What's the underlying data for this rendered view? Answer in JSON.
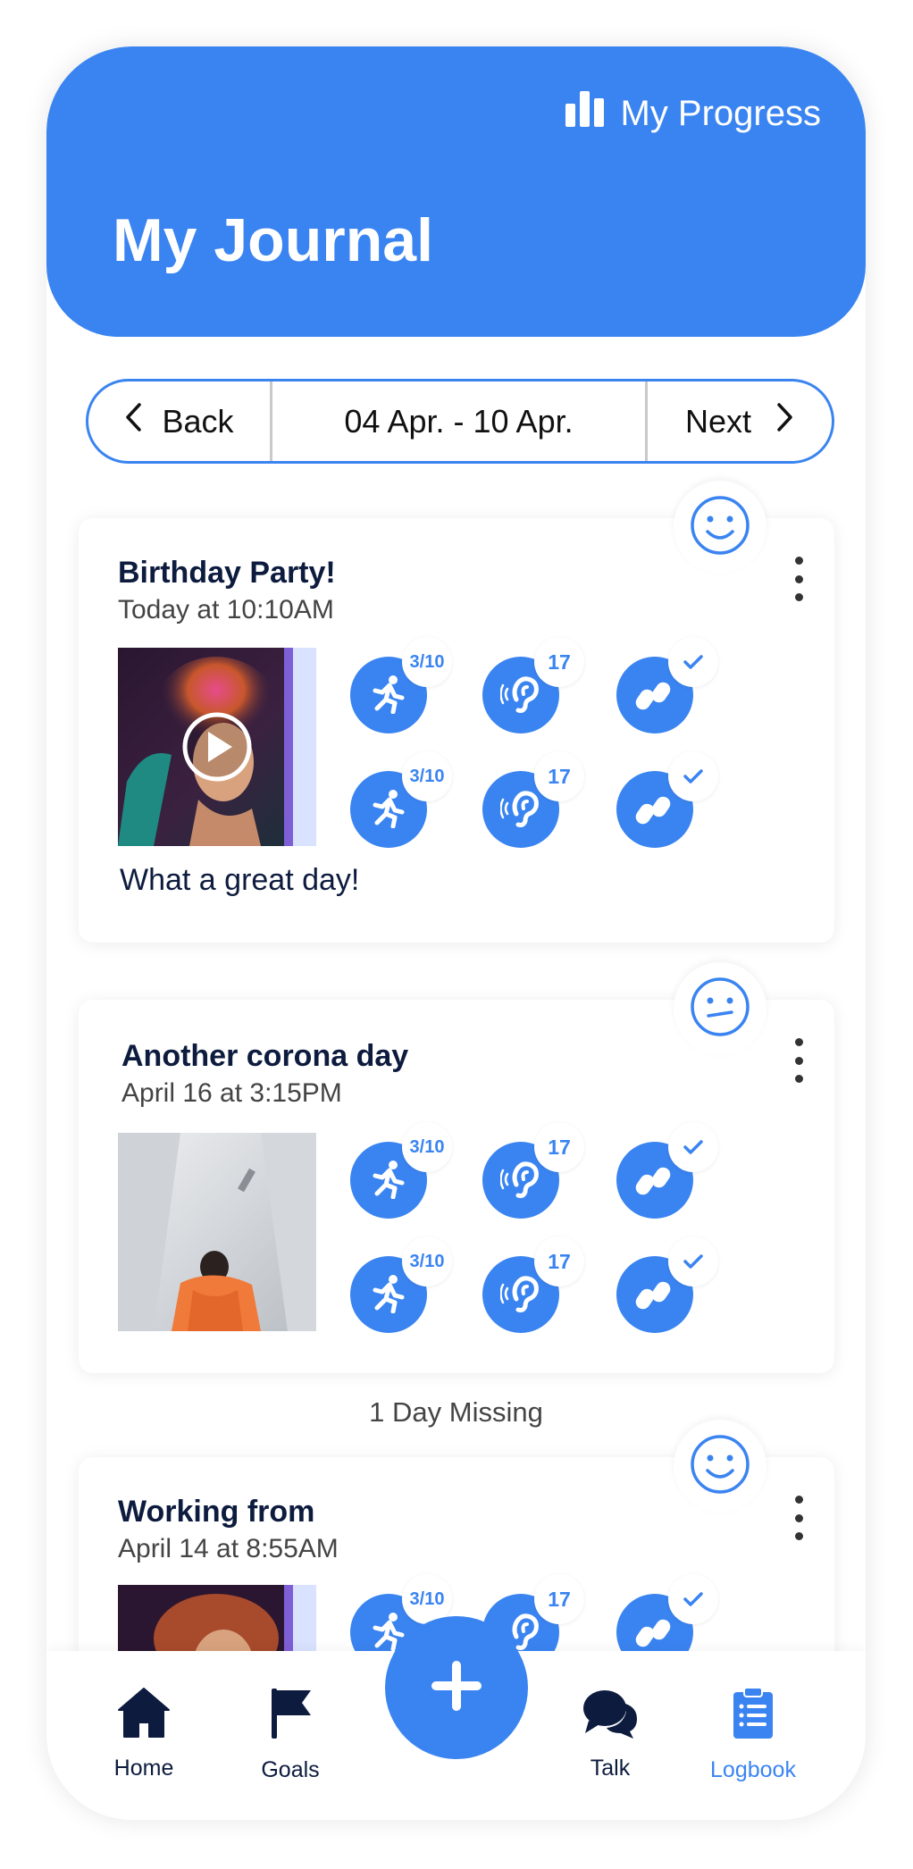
{
  "header": {
    "progress_label": "My Progress",
    "title": "My Journal"
  },
  "week_nav": {
    "back_label": "Back",
    "range": "04 Apr. - 10 Apr.",
    "next_label": "Next"
  },
  "entries": [
    {
      "title": "Birthday Party!",
      "date": "Today at 10:10AM",
      "mood": "happy",
      "note": "What a great day!",
      "stats": [
        "3/10",
        "17",
        "check",
        "3/10",
        "17",
        "check"
      ]
    },
    {
      "title": "Another corona day",
      "date": "April 16 at 3:15PM",
      "mood": "neutral",
      "stats": [
        "3/10",
        "17",
        "check",
        "3/10",
        "17",
        "check"
      ]
    },
    {
      "title": "Working from",
      "date": "April 14 at 8:55AM",
      "mood": "happy",
      "stats": [
        "3/10",
        "17",
        "check"
      ]
    }
  ],
  "missing_text": "1 Day Missing",
  "tabbar": {
    "home": "Home",
    "goals": "Goals",
    "talk": "Talk",
    "logbook": "Logbook"
  },
  "colors": {
    "accent": "#3a84f1",
    "navy": "#0d1b3e"
  },
  "icons": [
    "bar-chart-icon",
    "chevron-left-icon",
    "chevron-right-icon",
    "smiley-icon",
    "neutral-face-icon",
    "running-icon",
    "ear-icon",
    "footprints-icon",
    "play-icon",
    "home-icon",
    "flag-icon",
    "plus-icon",
    "chat-icon",
    "clipboard-icon",
    "more-vertical-icon"
  ]
}
